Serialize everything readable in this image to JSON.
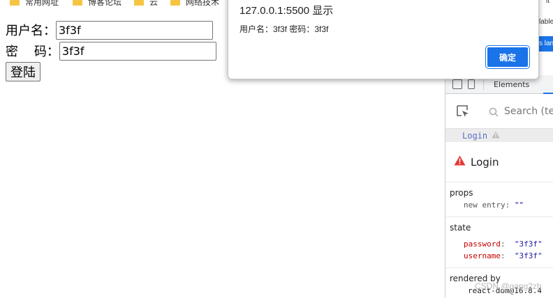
{
  "bookmarks": [
    "常用网址",
    "博客论坛",
    "云",
    "网络技术"
  ],
  "form": {
    "username_label": "用户名：",
    "username_value": "3f3f",
    "password_label": "密    码：",
    "password_value": "3f3f",
    "submit_label": "登陆"
  },
  "dialog": {
    "title": "127.0.0.1:5500 显示",
    "message": "用户名：3f3f 密码：3f3f",
    "ok_label": "确定"
  },
  "devtools": {
    "tab_elements": "Elements",
    "search_placeholder": "Search (te",
    "breadcrumb": "Login",
    "component_name": "Login",
    "props_title": "props",
    "props": [
      {
        "key": "new entry",
        "value": "\"\""
      }
    ],
    "state_title": "state",
    "state": [
      {
        "key": "password",
        "value": "\"3f3f\""
      },
      {
        "key": "username",
        "value": "\"3f3f\""
      }
    ],
    "rendered_by_title": "rendered by",
    "rendered_by_value": "react-dom@16.8.4"
  },
  "behind": {
    "text1": "lable",
    "text2": "s lan",
    "text3": "it"
  },
  "watermark": "CSDN @gang2zh",
  "colors": {
    "accent": "#1a73e8",
    "warning": "#e53935"
  }
}
